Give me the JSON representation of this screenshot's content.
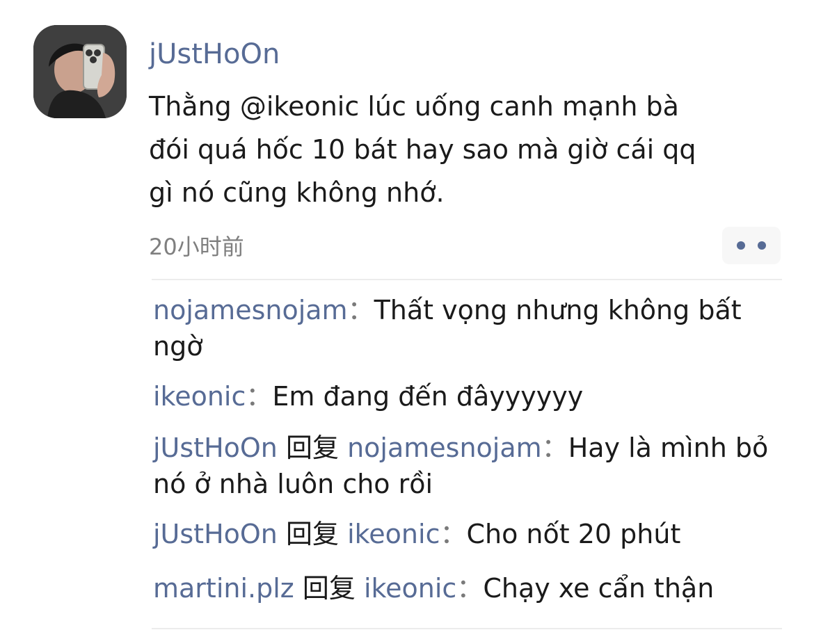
{
  "post": {
    "author": "jUstHoOn",
    "text": "Thằng @ikeonic lúc uống canh mạnh bà\nđói quá hốc 10 bát hay sao mà giờ cái qq\ngì nó cũng không nhớ.",
    "time": "20小时前",
    "more_icon": "more-dots-icon"
  },
  "comments": [
    {
      "author": "nojamesnojam",
      "separator": "：",
      "text": "Thất vọng nhưng không bất ngờ"
    },
    {
      "author": "ikeonic",
      "separator": "：",
      "text": "Em đang đến đâyyyyyy"
    },
    {
      "author": "jUstHoOn",
      "reply_word": "回复",
      "reply_to": "nojamesnojam",
      "separator": "：",
      "text": "Hay là mình bỏ nó ở nhà luôn cho rồi"
    },
    {
      "author": "jUstHoOn",
      "reply_word": "回复",
      "reply_to": "ikeonic",
      "separator": "：",
      "text": "Cho nốt 20 phút"
    },
    {
      "author": "martini.plz",
      "reply_word": "回复",
      "reply_to": "ikeonic",
      "separator": "：",
      "text": "Chạy xe cẩn thận"
    }
  ],
  "colors": {
    "name": "#576b95",
    "text": "#1a1a1a",
    "time": "#7f7f7f",
    "divider": "#ececec"
  }
}
